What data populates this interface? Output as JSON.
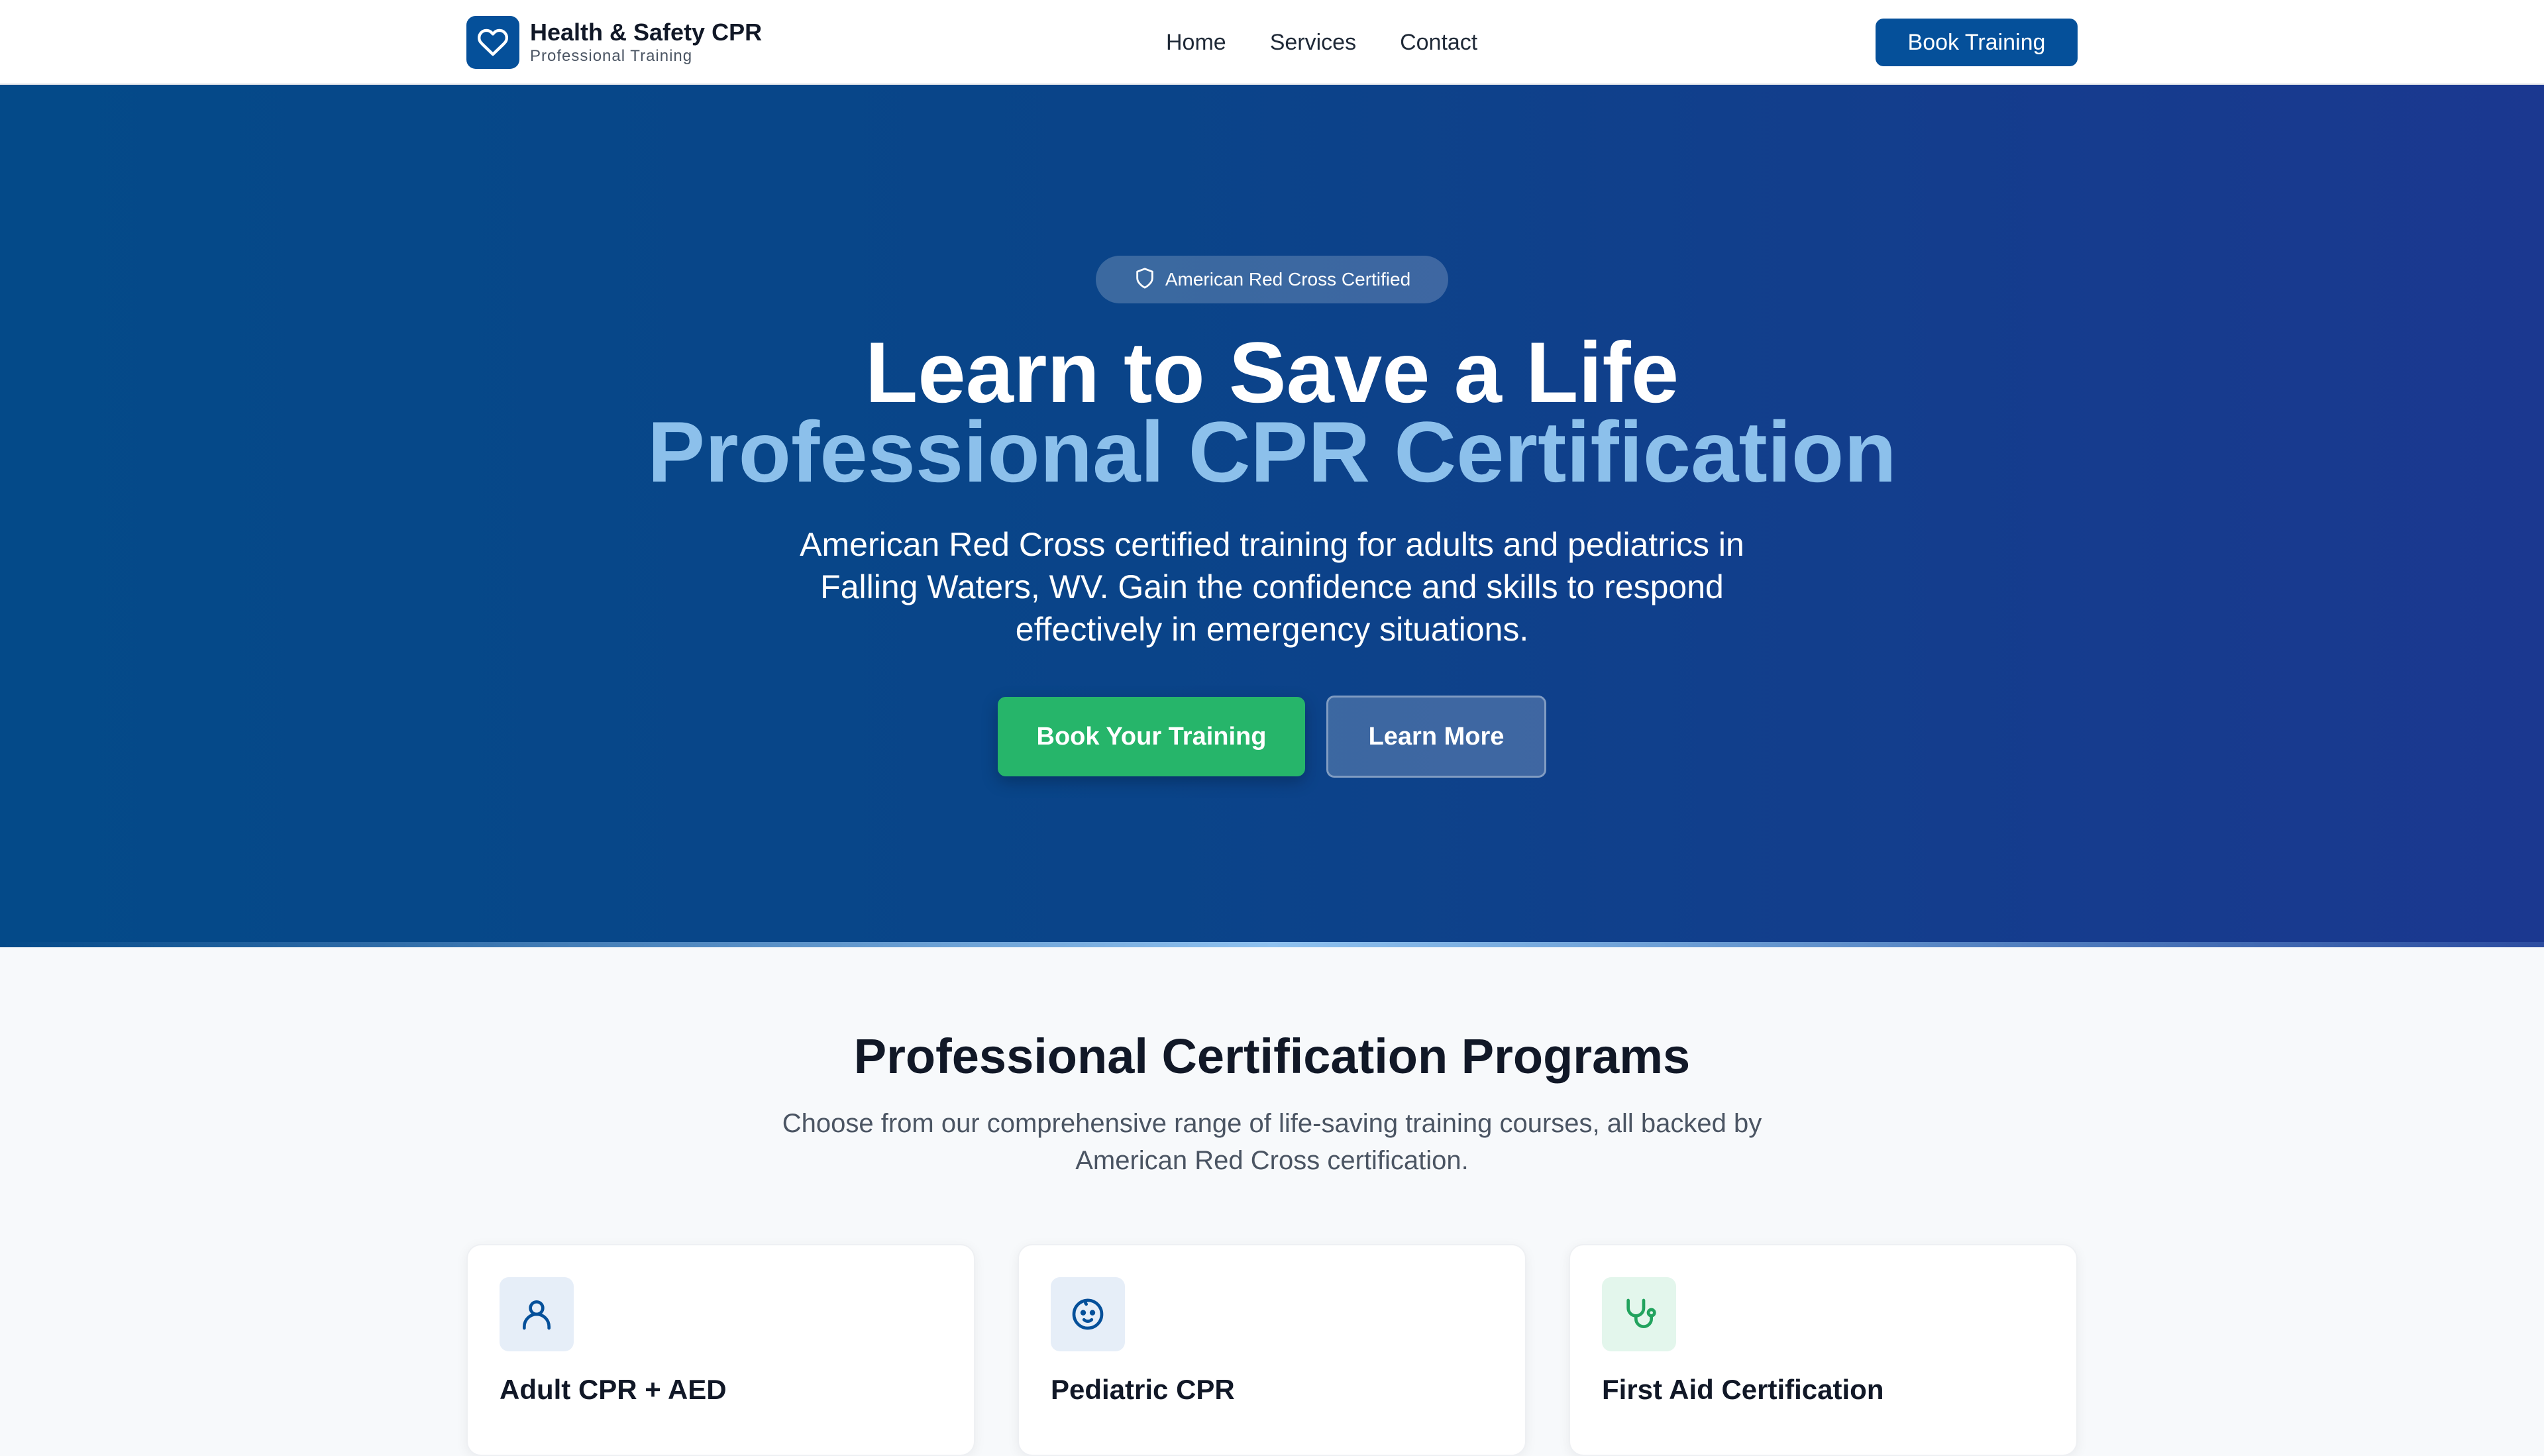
{
  "nav": {
    "brand_title": "Health & Safety CPR",
    "brand_subtitle": "Professional Training",
    "logo_icon": "heart-icon",
    "links": [
      {
        "label": "Home"
      },
      {
        "label": "Services"
      },
      {
        "label": "Contact"
      }
    ],
    "cta_label": "Book Training"
  },
  "hero": {
    "badge_icon": "shield-icon",
    "badge_text": "American Red Cross Certified",
    "title": "Learn to Save a Life",
    "title_accent": "Professional CPR Certification",
    "description": "American Red Cross certified training for adults and pediatrics in Falling Waters, WV. Gain the confidence and skills to respond effectively in emergency situations.",
    "primary_button": "Book Your Training",
    "secondary_button": "Learn More"
  },
  "programs": {
    "title": "Professional Certification Programs",
    "description": "Choose from our comprehensive range of life-saving training courses, all backed by American Red Cross certification.",
    "cards": [
      {
        "title": "Adult CPR + AED",
        "icon": "user-icon"
      },
      {
        "title": "Pediatric CPR",
        "icon": "baby-icon"
      },
      {
        "title": "First Aid Certification",
        "icon": "stethoscope-icon"
      }
    ]
  },
  "colors": {
    "primary": "#05509a",
    "hero_start": "#044a89",
    "hero_end": "#1b3890",
    "accent_text": "#8cc0eb",
    "success": "#26b56a"
  }
}
